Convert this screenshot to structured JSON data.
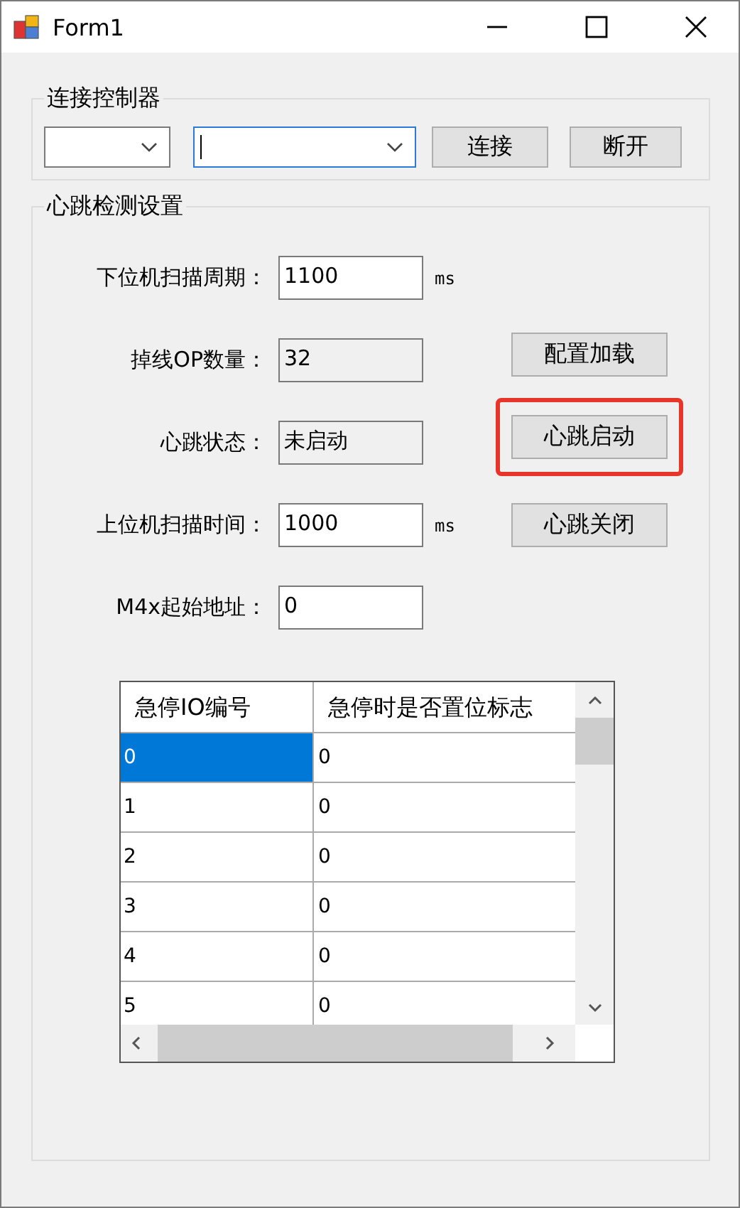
{
  "window": {
    "title": "Form1"
  },
  "connect_group": {
    "title": "连接控制器",
    "combos": [
      {
        "focused": false
      },
      {
        "focused": true
      }
    ],
    "buttons": [
      {
        "label": "连接"
      },
      {
        "label": "断开"
      }
    ]
  },
  "heartbeat_group": {
    "title": "心跳检测设置",
    "rows": [
      {
        "label": "下位机扫描周期：",
        "value": "1100",
        "readonly": false,
        "unit": "ms"
      },
      {
        "label": "掉线OP数量：",
        "value": "32",
        "readonly": true,
        "button": {
          "label": "配置加载",
          "highlighted": false
        }
      },
      {
        "label": "心跳状态：",
        "value": "未启动",
        "readonly": true,
        "button": {
          "label": "心跳启动",
          "highlighted": true
        }
      },
      {
        "label": "上位机扫描时间：",
        "value": "1000",
        "readonly": false,
        "unit": "ms",
        "button": {
          "label": "心跳关闭",
          "highlighted": false
        }
      },
      {
        "label": "M4x起始地址：",
        "value": "0",
        "readonly": false
      }
    ]
  },
  "table": {
    "columns": [
      "急停IO编号",
      "急停时是否置位标志"
    ],
    "rows": [
      {
        "cells": [
          "0",
          "0"
        ],
        "selected": true
      },
      {
        "cells": [
          "1",
          "0"
        ],
        "selected": false
      },
      {
        "cells": [
          "2",
          "0"
        ],
        "selected": false
      },
      {
        "cells": [
          "3",
          "0"
        ],
        "selected": false
      },
      {
        "cells": [
          "4",
          "0"
        ],
        "selected": false
      },
      {
        "cells": [
          "5",
          "0"
        ],
        "selected": false
      }
    ]
  }
}
